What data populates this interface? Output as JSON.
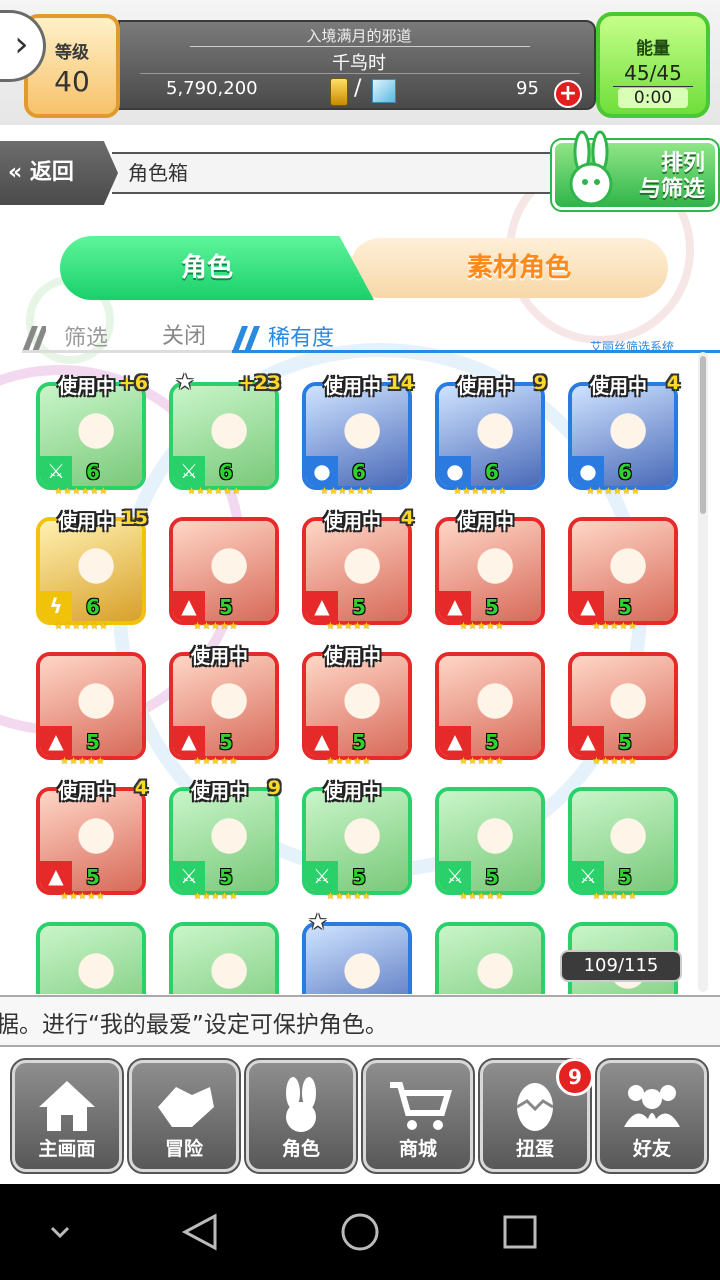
{
  "header": {
    "level_label": "等级",
    "level_value": "40",
    "chapter": "入境满月的邪道",
    "stage": "千鸟时",
    "gold": "5,790,200",
    "separator": "/",
    "gems": "95",
    "energy_label": "能量",
    "energy_value": "45/45",
    "energy_timer": "0:00"
  },
  "nav": {
    "back_label": "返回",
    "title": "角色箱",
    "sort_label_line1": "排列",
    "sort_label_line2": "与筛选"
  },
  "tabs": {
    "characters": "角色",
    "materials": "素材角色"
  },
  "filter": {
    "filter_label": "筛选",
    "off_label": "关闭",
    "rarity_label": "稀有度",
    "system_label": "艾丽丝筛选系统"
  },
  "colors": {
    "green": "#2ad16a",
    "red": "#e62a2a",
    "blue": "#2a7ae0",
    "yellow": "#f0c20a"
  },
  "cards": [
    {
      "frame": "green",
      "element": "wood",
      "level": "6",
      "in_use": "使用中",
      "plus": "+6",
      "fav": false,
      "stars": 6
    },
    {
      "frame": "green",
      "element": "wood",
      "level": "6",
      "in_use": "",
      "plus": "+23",
      "fav": true,
      "stars": 6
    },
    {
      "frame": "blue",
      "element": "water",
      "level": "6",
      "in_use": "使用中",
      "plus": "14",
      "fav": false,
      "stars": 6
    },
    {
      "frame": "blue",
      "element": "water",
      "level": "6",
      "in_use": "使用中",
      "plus": "9",
      "fav": false,
      "stars": 6
    },
    {
      "frame": "blue",
      "element": "water",
      "level": "6",
      "in_use": "使用中",
      "plus": "4",
      "fav": false,
      "stars": 6
    },
    {
      "frame": "yellow",
      "element": "thunder",
      "level": "6",
      "in_use": "使用中",
      "plus": "15",
      "fav": false,
      "stars": 6
    },
    {
      "frame": "red",
      "element": "fire",
      "level": "5",
      "in_use": "",
      "plus": "",
      "fav": false,
      "stars": 5
    },
    {
      "frame": "red",
      "element": "fire",
      "level": "5",
      "in_use": "使用中",
      "plus": "4",
      "fav": false,
      "stars": 5
    },
    {
      "frame": "red",
      "element": "fire",
      "level": "5",
      "in_use": "使用中",
      "plus": "",
      "fav": false,
      "stars": 5
    },
    {
      "frame": "red",
      "element": "fire",
      "level": "5",
      "in_use": "",
      "plus": "",
      "fav": false,
      "stars": 5
    },
    {
      "frame": "red",
      "element": "fire",
      "level": "5",
      "in_use": "",
      "plus": "",
      "fav": false,
      "stars": 5
    },
    {
      "frame": "red",
      "element": "fire",
      "level": "5",
      "in_use": "使用中",
      "plus": "",
      "fav": false,
      "stars": 5
    },
    {
      "frame": "red",
      "element": "fire",
      "level": "5",
      "in_use": "使用中",
      "plus": "",
      "fav": false,
      "stars": 5
    },
    {
      "frame": "red",
      "element": "fire",
      "level": "5",
      "in_use": "",
      "plus": "",
      "fav": false,
      "stars": 5
    },
    {
      "frame": "red",
      "element": "fire",
      "level": "5",
      "in_use": "",
      "plus": "",
      "fav": false,
      "stars": 5
    },
    {
      "frame": "red",
      "element": "fire",
      "level": "5",
      "in_use": "使用中",
      "plus": "4",
      "fav": false,
      "stars": 5
    },
    {
      "frame": "green",
      "element": "wood",
      "level": "5",
      "in_use": "使用中",
      "plus": "9",
      "fav": false,
      "stars": 5
    },
    {
      "frame": "green",
      "element": "wood",
      "level": "5",
      "in_use": "使用中",
      "plus": "",
      "fav": false,
      "stars": 5
    },
    {
      "frame": "green",
      "element": "wood",
      "level": "5",
      "in_use": "",
      "plus": "",
      "fav": false,
      "stars": 5
    },
    {
      "frame": "green",
      "element": "wood",
      "level": "5",
      "in_use": "",
      "plus": "",
      "fav": false,
      "stars": 5
    },
    {
      "frame": "green",
      "element": "",
      "level": "",
      "in_use": "",
      "plus": "",
      "fav": false,
      "stars": 0
    },
    {
      "frame": "green",
      "element": "",
      "level": "",
      "in_use": "",
      "plus": "",
      "fav": false,
      "stars": 0
    },
    {
      "frame": "blue",
      "element": "",
      "level": "",
      "in_use": "",
      "plus": "",
      "fav": true,
      "stars": 0
    },
    {
      "frame": "green",
      "element": "",
      "level": "",
      "in_use": "",
      "plus": "",
      "fav": false,
      "stars": 0
    },
    {
      "frame": "green",
      "element": "",
      "level": "",
      "in_use": "",
      "plus": "",
      "fav": false,
      "stars": 0
    }
  ],
  "box_count": "109/115",
  "ticker": "据。进行“我的最爱”设定可保护角色。",
  "bottom_nav": [
    {
      "label": "主画面",
      "icon": "home-icon"
    },
    {
      "label": "冒险",
      "icon": "handshake-icon"
    },
    {
      "label": "角色",
      "icon": "rabbit-icon"
    },
    {
      "label": "商城",
      "icon": "cart-icon"
    },
    {
      "label": "扭蛋",
      "icon": "egg-icon"
    },
    {
      "label": "好友",
      "icon": "friends-icon"
    }
  ],
  "gacha_badge": "9"
}
